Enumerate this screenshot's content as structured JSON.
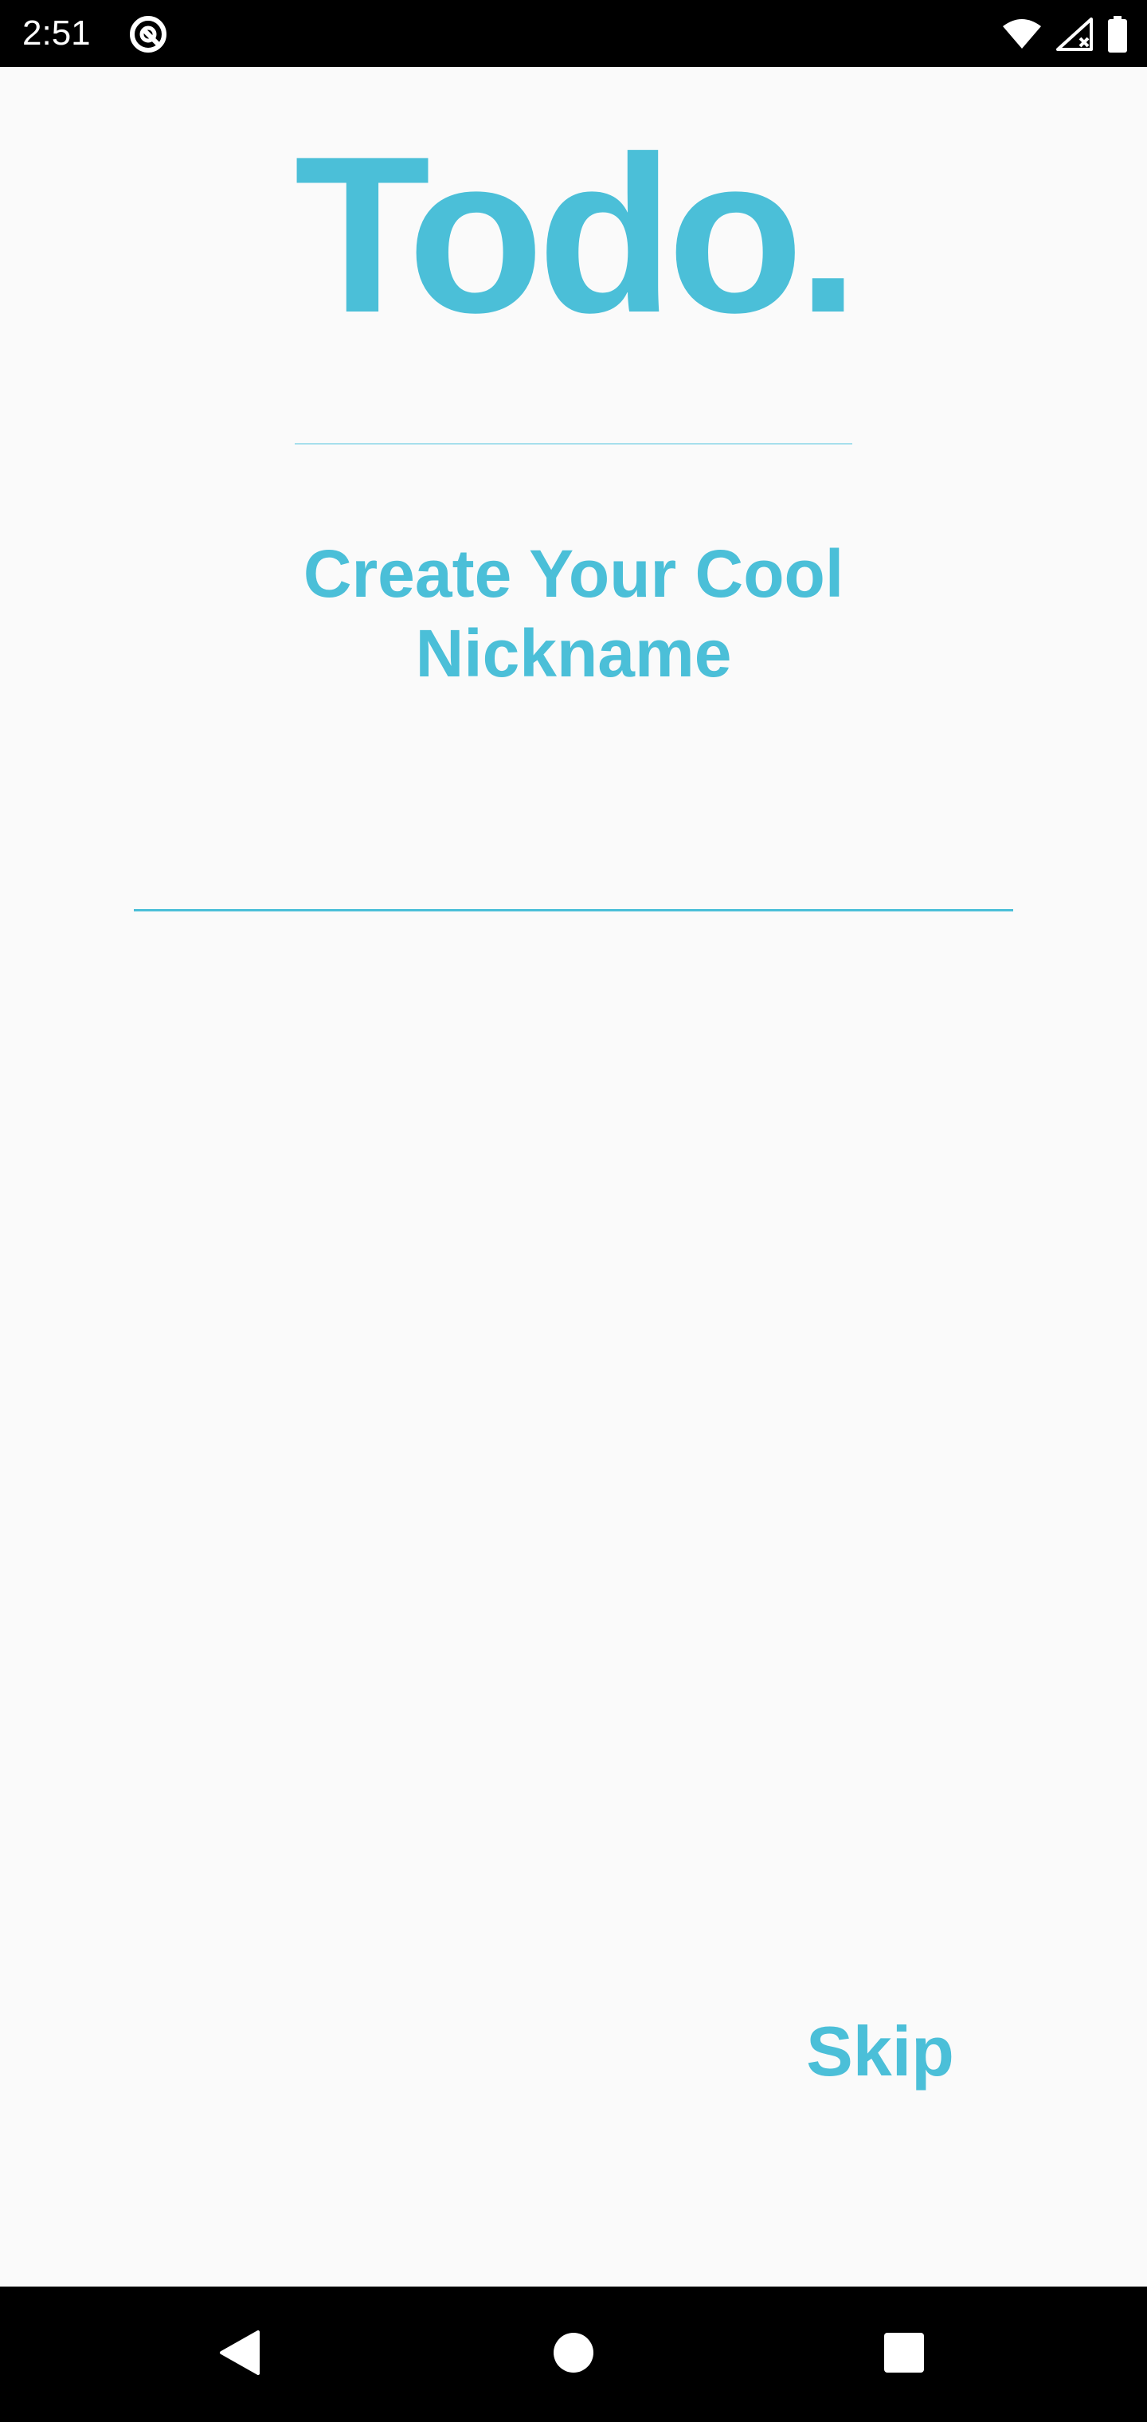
{
  "status_bar": {
    "time": "2:51",
    "icons": [
      "app-notification-icon",
      "wifi-icon",
      "cell-signal-icon",
      "battery-icon"
    ]
  },
  "app": {
    "title": "Todo.",
    "subtitle": "Create Your Cool Nickname",
    "nickname_input": {
      "value": "",
      "placeholder": ""
    },
    "skip_label": "Skip"
  },
  "nav_bar": {
    "icons": [
      "back-icon",
      "home-icon",
      "recents-icon"
    ]
  },
  "colors": {
    "accent": "#4bbfd8",
    "background": "#fafafa",
    "bars": "#000000"
  }
}
